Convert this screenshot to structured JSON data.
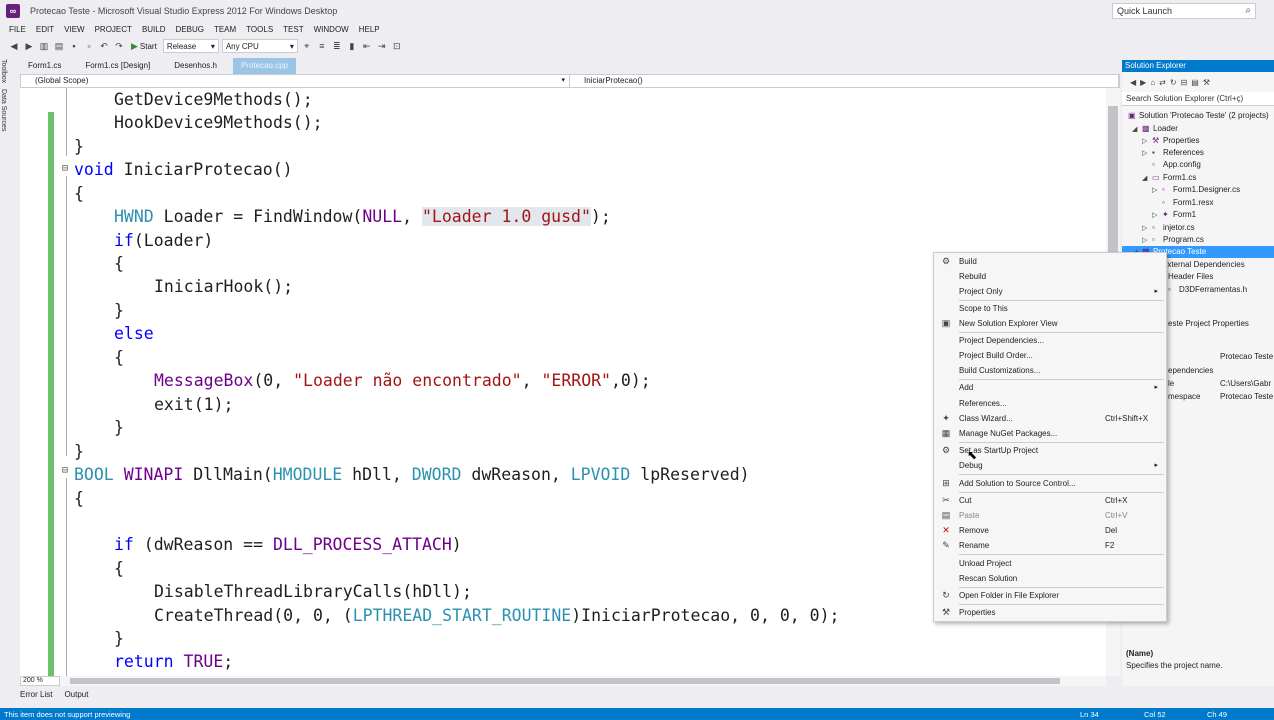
{
  "window": {
    "title": "Protecao Teste - Microsoft Visual Studio Express 2012 For Windows Desktop",
    "quick_launch": "Quick Launch"
  },
  "menu": [
    "FILE",
    "EDIT",
    "VIEW",
    "PROJECT",
    "BUILD",
    "DEBUG",
    "TEAM",
    "TOOLS",
    "TEST",
    "WINDOW",
    "HELP"
  ],
  "toolbar": {
    "start_label": "Start",
    "config": "Release",
    "platform": "Any CPU"
  },
  "left_tabs": [
    "Toolbox",
    "Data Sources"
  ],
  "doc_tabs": [
    "Form1.cs",
    "Form1.cs [Design]",
    "Desenhos.h",
    "Protecao.cpp"
  ],
  "nav": {
    "scope": "(Global Scope)",
    "member": "IniciarProtecao()"
  },
  "code": {
    "l1": "GetDevice9Methods();",
    "l2": "HookDevice9Methods();",
    "l3": "}",
    "l4_kw": "void",
    "l4_rest": " IniciarProtecao()",
    "l5": "{",
    "l6_ty": "HWND",
    "l6_mid": " Loader = FindWindow(",
    "l6_mac": "NULL",
    "l6_sep": ", ",
    "l6_str": "\"Loader 1.0 gusd\"",
    "l6_end": ");",
    "l7_kw": "if",
    "l7_rest": "(Loader)",
    "l8": "{",
    "l9": "IniciarHook();",
    "l10": "}",
    "l11": "else",
    "l12": "{",
    "l13_mac": "MessageBox",
    "l13_a": "(0, ",
    "l13_s1": "\"Loader não encontrado\"",
    "l13_b": ", ",
    "l13_s2": "\"ERROR\"",
    "l13_c": ",0);",
    "l14": "exit(1);",
    "l15": "}",
    "l16": "}",
    "l17_t1": "BOOL",
    "l17_t2": "WINAPI",
    "l17_fn": " DllMain(",
    "l17_t3": "HMODULE",
    "l17_p1": " hDll, ",
    "l17_t4": "DWORD",
    "l17_p2": " dwReason, ",
    "l17_t5": "LPVOID",
    "l17_p3": " lpReserved)",
    "l18": "{",
    "l19_kw": "if",
    "l19_a": " (dwReason == ",
    "l19_mac": "DLL_PROCESS_ATTACH",
    "l19_b": ")",
    "l20": "{",
    "l21": "DisableThreadLibraryCalls(hDll);",
    "l22_a": "CreateThread(0, 0, (",
    "l22_ty": "LPTHREAD_START_ROUTINE",
    "l22_b": ")IniciarProtecao, 0, 0, 0);",
    "l23": "}",
    "l24_kw": "return",
    "l24_mac": "TRUE",
    "l24_end": ";"
  },
  "zoom": "200 %",
  "bottom_tabs": [
    "Error List",
    "Output"
  ],
  "status": {
    "message": "This item does not support previewing",
    "ln": "Ln 34",
    "col": "Col 52",
    "ch": "Ch 49"
  },
  "solution_explorer": {
    "title": "Solution Explorer",
    "search": "Search Solution Explorer (Ctrl+ç)",
    "items": [
      "Solution 'Protecao Teste' (2 projects)",
      "Loader",
      "Properties",
      "References",
      "App.config",
      "Form1.cs",
      "Form1.Designer.cs",
      "Form1.resx",
      "Form1",
      "injetor.cs",
      "Program.cs",
      "Protecao Teste",
      "External Dependencies",
      "Header Files",
      "D3DFerramentas.h"
    ],
    "props_title": "este  Project Properties",
    "props": [
      [
        "",
        "Protecao Teste"
      ],
      [
        "ependencies",
        ""
      ],
      [
        "le",
        "C:\\Users\\Gabr"
      ],
      [
        "mespace",
        "Protecao Teste"
      ]
    ],
    "desc_name": "(Name)",
    "desc_text": "Specifies the project name."
  },
  "context_menu": {
    "items": [
      {
        "label": "Build",
        "shortcut": "",
        "icon": "gear-icon",
        "glyph": "⚙"
      },
      {
        "label": "Rebuild",
        "shortcut": "",
        "icon": "",
        "glyph": ""
      },
      {
        "label": "Project Only",
        "shortcut": "",
        "icon": "",
        "glyph": "",
        "sub": "▸"
      },
      {
        "label": "Scope to This",
        "shortcut": "",
        "icon": "",
        "glyph": ""
      },
      {
        "label": "New Solution Explorer View",
        "shortcut": "",
        "icon": "window-icon",
        "glyph": "▣"
      },
      {
        "label": "Project Dependencies...",
        "shortcut": "",
        "icon": "",
        "glyph": ""
      },
      {
        "label": "Project Build Order...",
        "shortcut": "",
        "icon": "",
        "glyph": ""
      },
      {
        "label": "Build Customizations...",
        "shortcut": "",
        "icon": "",
        "glyph": ""
      },
      {
        "label": "Add",
        "shortcut": "",
        "icon": "",
        "glyph": "",
        "sub": "▸"
      },
      {
        "label": "References...",
        "shortcut": "",
        "icon": "",
        "glyph": ""
      },
      {
        "label": "Class Wizard...",
        "shortcut": "Ctrl+Shift+X",
        "icon": "wizard-icon",
        "glyph": "✦"
      },
      {
        "label": "Manage NuGet Packages...",
        "shortcut": "",
        "icon": "package-icon",
        "glyph": "▦"
      },
      {
        "label": "Set as StartUp Project",
        "shortcut": "",
        "icon": "startup-gear-icon",
        "glyph": "⚙"
      },
      {
        "label": "Debug",
        "shortcut": "",
        "icon": "",
        "glyph": "",
        "sub": "▸"
      },
      {
        "label": "Add Solution to Source Control...",
        "shortcut": "",
        "icon": "source-control-icon",
        "glyph": "⊞"
      },
      {
        "label": "Cut",
        "shortcut": "Ctrl+X",
        "icon": "cut-icon",
        "glyph": "✂"
      },
      {
        "label": "Paste",
        "shortcut": "Ctrl+V",
        "icon": "paste-icon",
        "glyph": "▤"
      },
      {
        "label": "Remove",
        "shortcut": "Del",
        "icon": "remove-icon",
        "glyph": "✕"
      },
      {
        "label": "Rename",
        "shortcut": "F2",
        "icon": "rename-icon",
        "glyph": "✎"
      },
      {
        "label": "Unload Project",
        "shortcut": "",
        "icon": "",
        "glyph": ""
      },
      {
        "label": "Rescan Solution",
        "shortcut": "",
        "icon": "",
        "glyph": ""
      },
      {
        "label": "Open Folder in File Explorer",
        "shortcut": "",
        "icon": "refresh-icon",
        "glyph": "↻"
      },
      {
        "label": "Properties",
        "shortcut": "",
        "icon": "wrench-icon",
        "glyph": "⚒"
      }
    ]
  }
}
